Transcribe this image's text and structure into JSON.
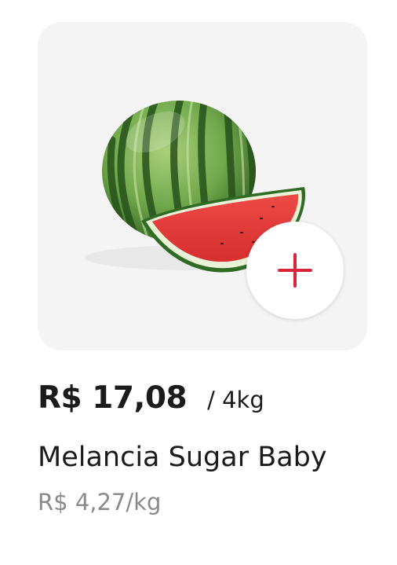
{
  "product": {
    "price": "R$ 17,08",
    "unit": "/ 4kg",
    "name": "Melancia Sugar Baby",
    "price_per_kg": "R$ 4,27/kg",
    "image_icon": "watermelon-image"
  },
  "actions": {
    "add_icon": "plus-icon"
  },
  "colors": {
    "card_background": "#f4f4f4",
    "accent": "#d7263d",
    "price_text": "#1b1b1b",
    "secondary_text": "#8a8a8a"
  }
}
